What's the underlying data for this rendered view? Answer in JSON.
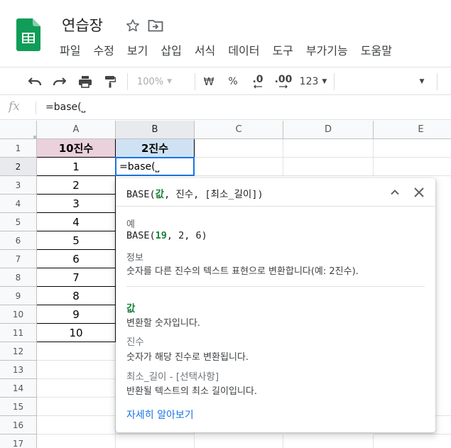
{
  "app": {
    "title": "연습장",
    "menu": [
      "파일",
      "수정",
      "보기",
      "삽입",
      "서식",
      "데이터",
      "도구",
      "부가기능",
      "도움말"
    ]
  },
  "toolbar": {
    "zoom": "100%",
    "currency": "₩",
    "percent": "%",
    "dec_less": ".0",
    "dec_more": ".00",
    "format": "123"
  },
  "formula_bar": {
    "fx": "fx",
    "value": "=base(⎵"
  },
  "grid": {
    "columns": [
      "A",
      "B",
      "C",
      "D",
      "E"
    ],
    "rows": [
      "1",
      "2",
      "3",
      "4",
      "5",
      "6",
      "7",
      "8",
      "9",
      "10",
      "11",
      "12",
      "13",
      "14",
      "15",
      "16",
      "17"
    ],
    "header_a": "10진수",
    "header_b": "2진수",
    "col_a_values": [
      "1",
      "2",
      "3",
      "4",
      "5",
      "6",
      "7",
      "8",
      "9",
      "10"
    ],
    "active_cell_value": "=base(⎵"
  },
  "help": {
    "sig_fn": "BASE(",
    "sig_arg_current": "값",
    "sig_rest": ", 진수, [최소_길이])",
    "example_label": "예",
    "example_fn": "BASE(",
    "example_num": "19",
    "example_rest": ", 2, 6)",
    "info_label": "정보",
    "info_text": "숫자를 다른 진수의 텍스트 표현으로 변환합니다(예: 2진수).",
    "arg1_name": "값",
    "arg1_desc": "변환할 숫자입니다.",
    "arg2_name": "진수",
    "arg2_desc": "숫자가 해당 진수로 변환됩니다.",
    "arg3_name": "최소_길이 - [선택사항]",
    "arg3_desc": "반환될 텍스트의 최소 길이입니다.",
    "learn_more": "자세히 알아보기"
  },
  "colors": {
    "header_a_bg": "#ead1dc",
    "header_b_bg": "#cfe2f3",
    "active_border": "#1a73e8",
    "arg_green": "#188038",
    "link_blue": "#1a73e8"
  }
}
